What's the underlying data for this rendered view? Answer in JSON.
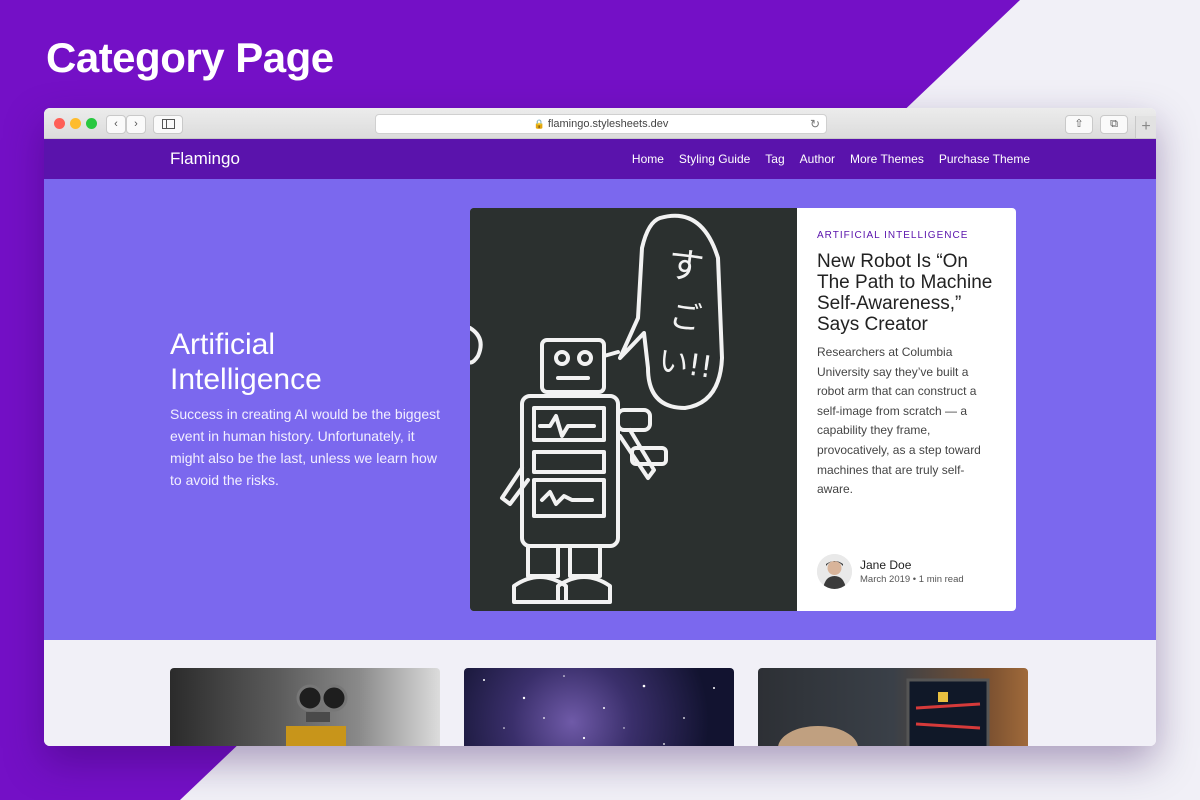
{
  "promo": {
    "title": "Category Page"
  },
  "browser": {
    "url": "flamingo.stylesheets.dev"
  },
  "site": {
    "name": "Flamingo",
    "nav": [
      "Home",
      "Styling Guide",
      "Tag",
      "Author",
      "More Themes",
      "Purchase Theme"
    ]
  },
  "category": {
    "title": "Artificial Intelligence",
    "description": "Success in creating AI would be the biggest event in human history. Unfortunately, it might also be the last, unless we learn how to avoid the risks."
  },
  "featured": {
    "category": "ARTIFICIAL INTELLIGENCE",
    "title": "New Robot Is “On The Path to Machine Self-Awareness,” Says Creator",
    "excerpt": "Researchers at Columbia University say they’ve built a robot arm that can construct a self-image from scratch — a capability they frame, provocatively, as a step toward machines that are truly self-aware.",
    "author": "Jane Doe",
    "meta": "March 2019 • 1 min read",
    "speech_text": "すごい!!"
  },
  "colors": {
    "background": "#7410c6",
    "nav": "#5a13ac",
    "hero": "#7b68ee",
    "accent": "#5a13ac"
  },
  "icons": [
    "back-arrow-icon",
    "forward-arrow-icon",
    "sidebar-icon",
    "lock-icon",
    "reload-icon",
    "share-icon",
    "tabs-icon",
    "plus-icon"
  ]
}
